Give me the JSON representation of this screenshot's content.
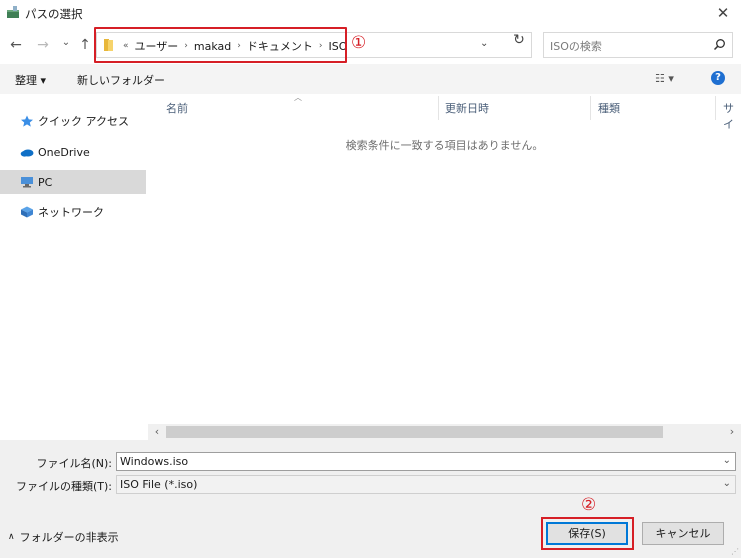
{
  "window": {
    "title": "パスの選択",
    "close_glyph": "✕"
  },
  "nav": {
    "back_glyph": "←",
    "forward_glyph": "→",
    "recent_glyph": "⌄",
    "up_glyph": "↑"
  },
  "address": {
    "overflow": "«",
    "crumbs": [
      "ユーザー",
      "makad",
      "ドキュメント",
      "ISO"
    ],
    "separator": "›",
    "dropdown_glyph": "⌄",
    "refresh_glyph": "↻"
  },
  "annotations": {
    "one": "①",
    "two": "②",
    "color": "#d61f26"
  },
  "search": {
    "placeholder": "ISOの検索"
  },
  "toolbar": {
    "organize_label": "整理 ▾",
    "new_folder_label": "新しいフォルダー",
    "view_label": "☷ ▾",
    "help_glyph": "?"
  },
  "sidebar": {
    "items": [
      {
        "label": "クイック アクセス",
        "icon": "star-icon"
      },
      {
        "label": "OneDrive",
        "icon": "cloud-icon"
      },
      {
        "label": "PC",
        "icon": "computer-icon",
        "selected": true
      },
      {
        "label": "ネットワーク",
        "icon": "network-icon"
      }
    ]
  },
  "columns": [
    "名前",
    "更新日時",
    "種類",
    "サイ"
  ],
  "empty_message": "検索条件に一致する項目はありません。",
  "scroll": {
    "left_glyph": "‹",
    "right_glyph": "›"
  },
  "form": {
    "filename_label": "ファイル名(N):",
    "filename_value": "Windows.iso",
    "filetype_label": "ファイルの種類(T):",
    "filetype_value": "ISO File (*.iso)",
    "chevron": "⌄"
  },
  "footer": {
    "hide_folders_label": "フォルダーの非表示",
    "hide_caret": "∧",
    "save_label": "保存(S)",
    "cancel_label": "キャンセル"
  },
  "colors": {
    "accent": "#0078d7",
    "folder": "#e8b73a",
    "help": "#1f6fd1"
  }
}
